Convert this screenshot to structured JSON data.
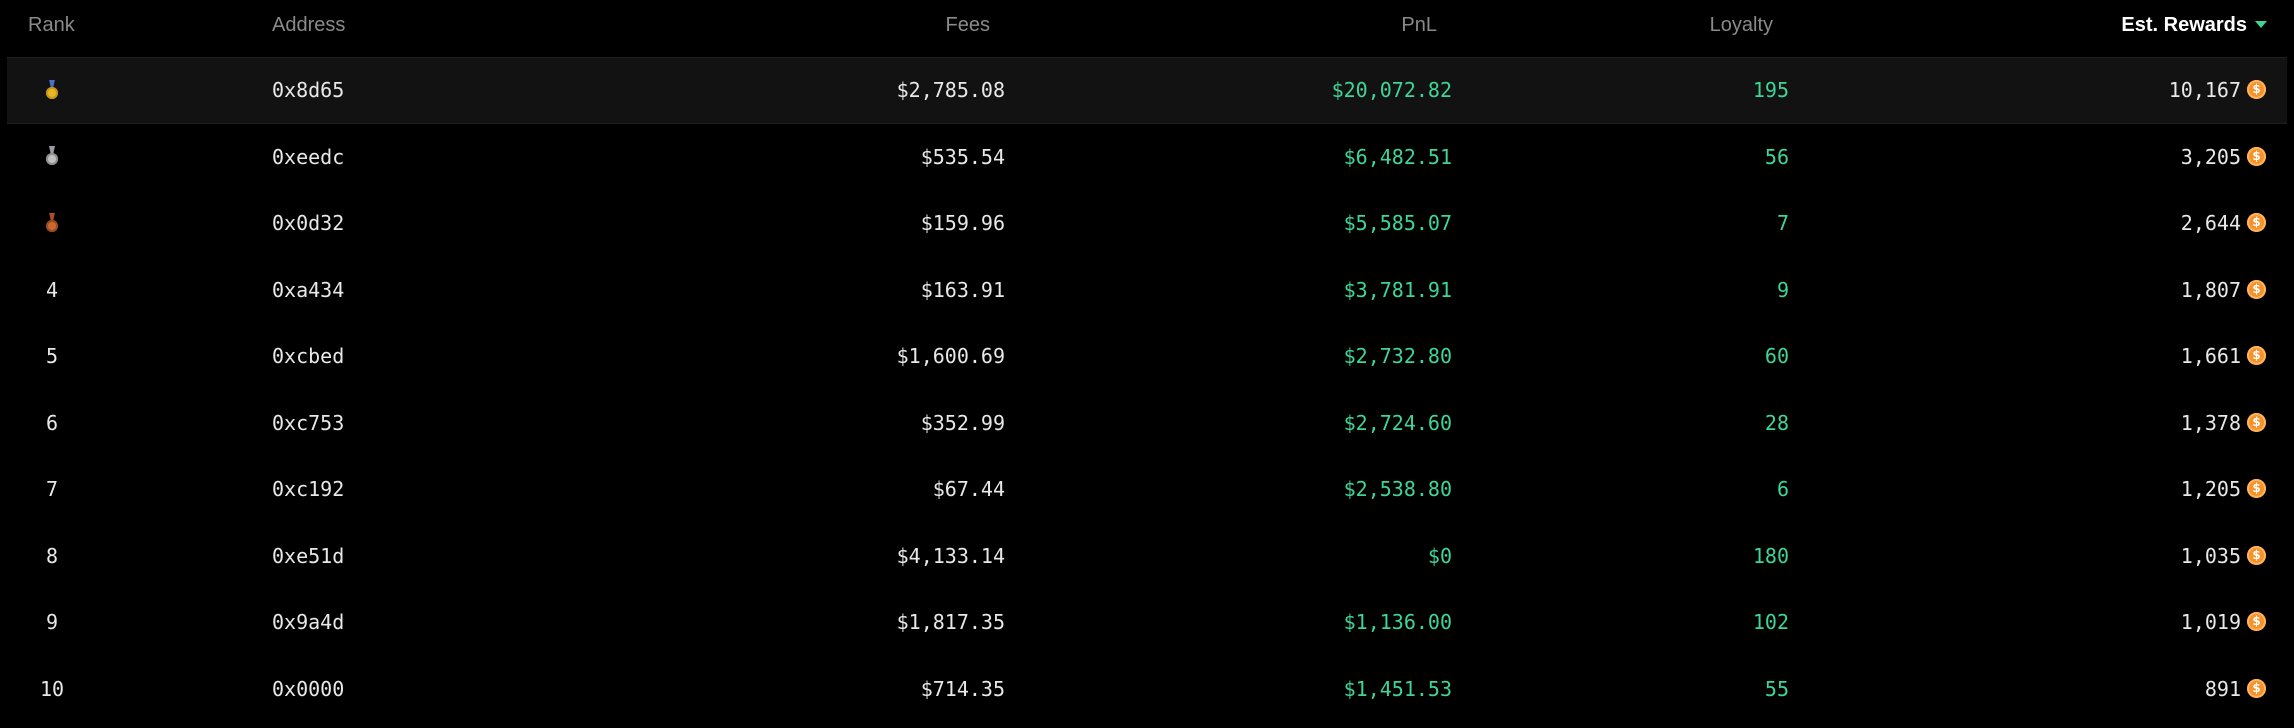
{
  "headers": {
    "rank": "Rank",
    "address": "Address",
    "fees": "Fees",
    "pnl": "PnL",
    "loyalty": "Loyalty",
    "est_rewards": "Est. Rewards"
  },
  "sort": {
    "column": "est_rewards",
    "direction": "desc"
  },
  "colors": {
    "background": "#000000",
    "positive": "#3ed598",
    "header_text": "#8a8a8a",
    "coin": "#f5922b"
  },
  "rows": [
    {
      "rank": "",
      "medal": "gold-medal-icon",
      "address": "0x8d65",
      "fees": "$2,785.08",
      "pnl": "$20,072.82",
      "loyalty": "195",
      "rewards": "10,167"
    },
    {
      "rank": "",
      "medal": "silver-medal-icon",
      "address": "0xeedc",
      "fees": "$535.54",
      "pnl": "$6,482.51",
      "loyalty": "56",
      "rewards": "3,205"
    },
    {
      "rank": "",
      "medal": "bronze-medal-icon",
      "address": "0x0d32",
      "fees": "$159.96",
      "pnl": "$5,585.07",
      "loyalty": "7",
      "rewards": "2,644"
    },
    {
      "rank": "4",
      "address": "0xa434",
      "fees": "$163.91",
      "pnl": "$3,781.91",
      "loyalty": "9",
      "rewards": "1,807"
    },
    {
      "rank": "5",
      "address": "0xcbed",
      "fees": "$1,600.69",
      "pnl": "$2,732.80",
      "loyalty": "60",
      "rewards": "1,661"
    },
    {
      "rank": "6",
      "address": "0xc753",
      "fees": "$352.99",
      "pnl": "$2,724.60",
      "loyalty": "28",
      "rewards": "1,378"
    },
    {
      "rank": "7",
      "address": "0xc192",
      "fees": "$67.44",
      "pnl": "$2,538.80",
      "loyalty": "6",
      "rewards": "1,205"
    },
    {
      "rank": "8",
      "address": "0xe51d",
      "fees": "$4,133.14",
      "pnl": "$0",
      "loyalty": "180",
      "rewards": "1,035"
    },
    {
      "rank": "9",
      "address": "0x9a4d",
      "fees": "$1,817.35",
      "pnl": "$1,136.00",
      "loyalty": "102",
      "rewards": "1,019"
    },
    {
      "rank": "10",
      "address": "0x0000",
      "fees": "$714.35",
      "pnl": "$1,451.53",
      "loyalty": "55",
      "rewards": "891"
    }
  ]
}
